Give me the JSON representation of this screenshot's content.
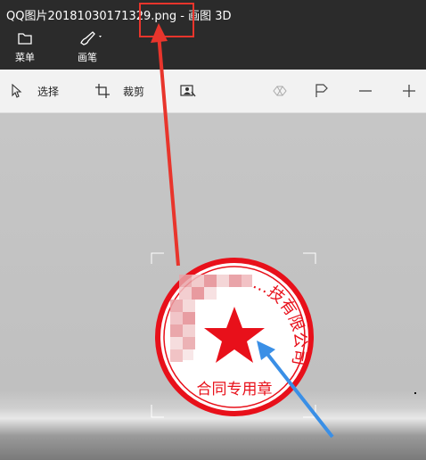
{
  "window": {
    "title": "QQ图片20181030171329.png - 画图 3D"
  },
  "topbar": {
    "menu_label": "菜单",
    "brush_label": "画笔"
  },
  "toolbar": {
    "select_label": "选择",
    "crop_label": "裁剪"
  },
  "stamp": {
    "outer_text": "…技有限公司",
    "bottom_text": "合同专用章",
    "color": "#e8101a"
  },
  "annotations": {
    "red_arrow_color": "#e8352c",
    "blue_arrow_color": "#3a8fe6"
  }
}
